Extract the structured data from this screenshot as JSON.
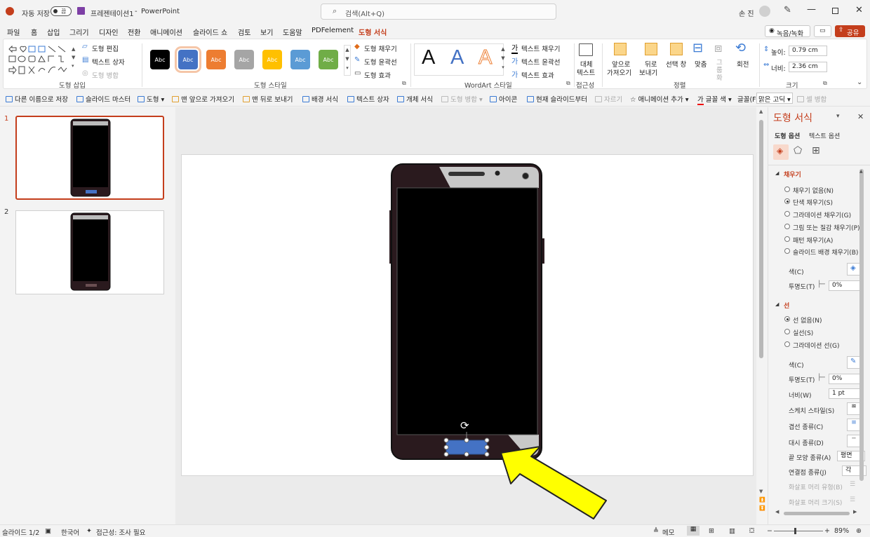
{
  "titlebar": {
    "autosave_label": "자동 저장",
    "autosave_state": "끔",
    "doc_title": "프레젠테이션1",
    "separator": "-",
    "app_name": "PowerPoint",
    "search_placeholder": "검색(Alt+Q)",
    "user_name": "손 진"
  },
  "menu": {
    "tabs": [
      "파일",
      "홈",
      "삽입",
      "그리기",
      "디자인",
      "전환",
      "애니메이션",
      "슬라이드 쇼",
      "검토",
      "보기",
      "도움말",
      "PDFelement",
      "도형 서식"
    ],
    "record_label": "녹음/녹화",
    "share_label": "공유"
  },
  "ribbon": {
    "edit_shape": "도형 편집",
    "text_box": "텍스트 상자",
    "merge_shapes": "도형 병합",
    "group_insert_shapes": "도형 삽입",
    "style_swatches": [
      "Abc",
      "Abc",
      "Abc",
      "Abc",
      "Abc",
      "Abc",
      "Abc"
    ],
    "swatch_colors": [
      "#000000",
      "#4472c4",
      "#ed7d31",
      "#a5a5a5",
      "#ffc000",
      "#5b9bd5",
      "#70ad47"
    ],
    "shape_fill": "도형 채우기",
    "shape_outline": "도형 윤곽선",
    "shape_effects": "도형 효과",
    "group_shape_styles": "도형 스타일",
    "wordart_letter": "A",
    "text_fill": "텍스트 채우기",
    "text_outline": "텍스트 윤곽선",
    "text_effects": "텍스트 효과",
    "group_wordart": "WordArt 스타일",
    "alt_text_line1": "대체",
    "alt_text_line2": "텍스트",
    "group_accessibility": "접근성",
    "bring_forward_1": "앞으로",
    "bring_forward_2": "가져오기",
    "send_backward_1": "뒤로",
    "send_backward_2": "보내기",
    "selection_pane": "선택 창",
    "align": "맞춤",
    "group": "그룹화",
    "rotate": "회전",
    "group_arrange": "정렬",
    "height_label": "높이:",
    "height_value": "0.79 cm",
    "width_label": "너비:",
    "width_value": "2.36 cm",
    "group_size": "크기"
  },
  "qat": {
    "items": [
      "다른 이름으로 저장",
      "슬라이드 마스터",
      "도형",
      "맨 앞으로 가져오기",
      "맨 뒤로 보내기",
      "배경 서식",
      "텍스트 상자",
      "개체 서식",
      "도형 병합",
      "아이콘",
      "현재 슬라이드부터",
      "자르기",
      "애니메이션 추가",
      "글꼴 색",
      "글꼴(F):",
      "맑은 고딕",
      "셀 병합"
    ]
  },
  "slides": {
    "numbers": [
      "1",
      "2"
    ]
  },
  "pane": {
    "title": "도형 서식",
    "tab_shape": "도형 옵션",
    "tab_text": "텍스트 옵션",
    "fill_section": "채우기",
    "fill_options": [
      "채우기 없음(N)",
      "단색 채우기(S)",
      "그라데이션 채우기(G)",
      "그림 또는 질감 채우기(P)",
      "패턴 채우기(A)",
      "슬라이드 배경 채우기(B)"
    ],
    "fill_selected": 1,
    "color_label": "색(C)",
    "transparency_label": "투명도(T)",
    "transparency_value": "0%",
    "line_section": "선",
    "line_options": [
      "선 없음(N)",
      "실선(S)",
      "그라데이션 선(G)"
    ],
    "line_selected": 0,
    "line_color_label": "색(C)",
    "line_transparency_label": "투명도(T)",
    "line_transparency_value": "0%",
    "width_label": "너비(W)",
    "width_value": "1 pt",
    "sketch_label": "스케치 스타일(S)",
    "compound_label": "겹선 종류(C)",
    "dash_label": "대시 종류(D)",
    "cap_label": "끝 모양 종류(A)",
    "cap_value": "평면",
    "join_label": "연결점 종류(J)",
    "join_value": "각",
    "arrow_begin_label": "화살표 머리 유형(B)",
    "arrow_size_label": "화살표 머리 크기(S)"
  },
  "status": {
    "slide_info": "슬라이드 1/2",
    "language": "한국어",
    "accessibility": "접근성: 조사 필요",
    "notes": "메모",
    "zoom": "89%"
  },
  "colors": {
    "accent": "#c43e1c",
    "selected_shape": "#4472c4",
    "arrow": "#ffff00"
  }
}
